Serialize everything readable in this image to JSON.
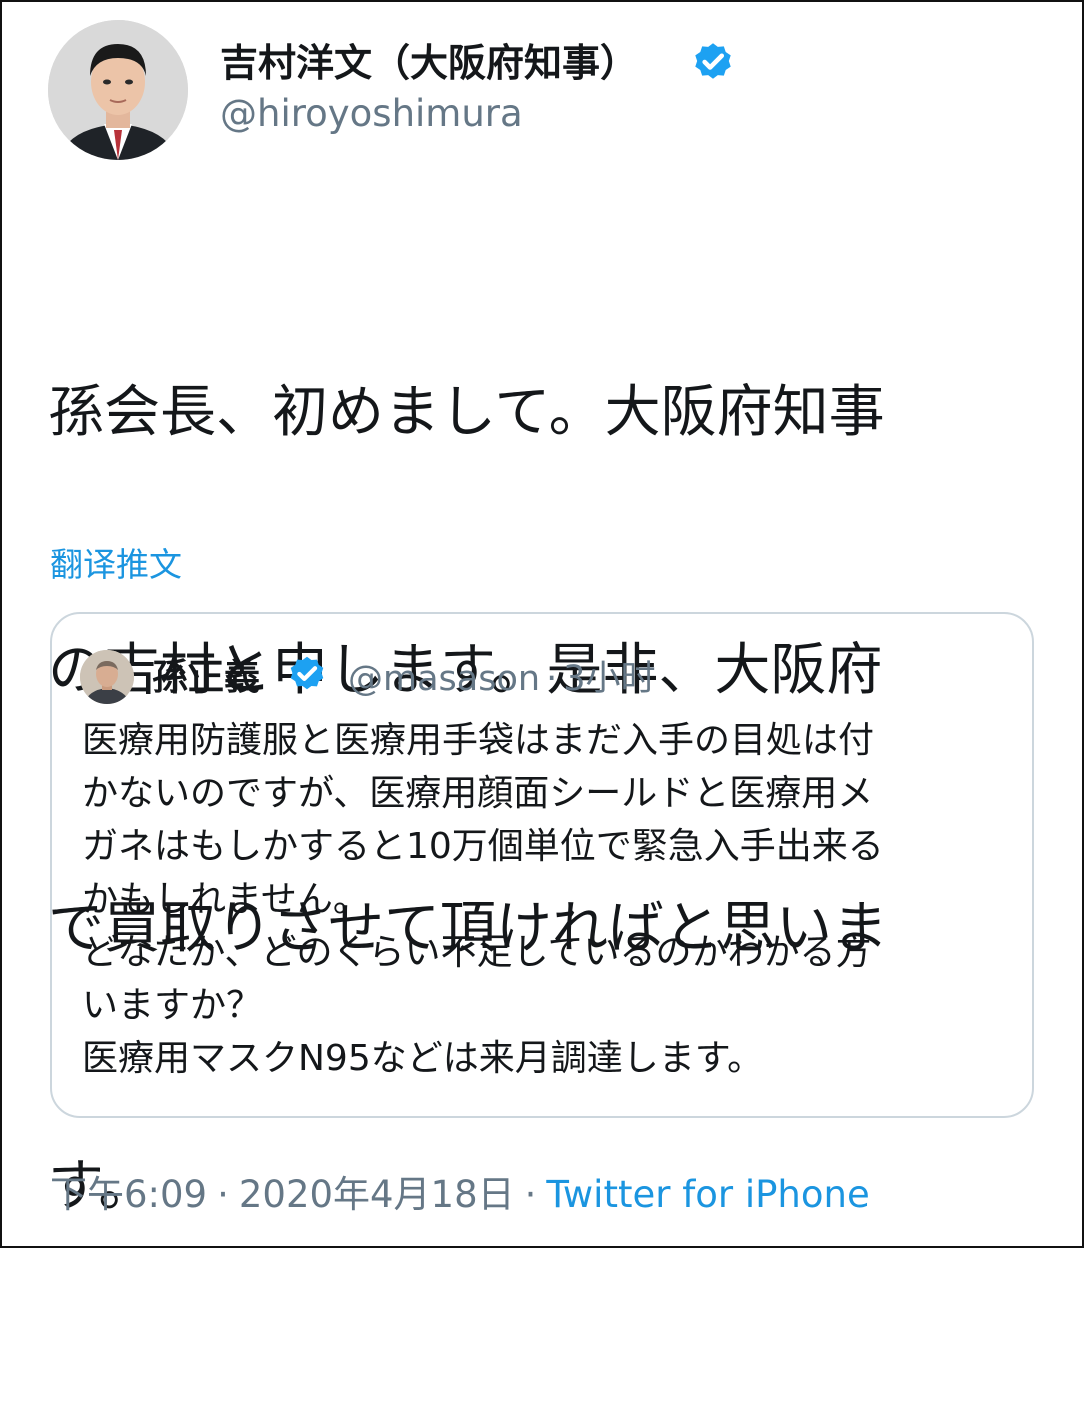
{
  "author": {
    "name": "吉村洋文（大阪府知事）",
    "handle": "@hiroyoshimura"
  },
  "tweet": {
    "text": "孫会長、初めまして。大阪府知事の吉村と申します。是非、大阪府で買取りさせて頂ければと思います。",
    "lines": [
      "孫会長、初めまして。大阪府知事",
      "の吉村と申します。是非、大阪府",
      "で買取りさせて頂ければと思いま",
      "す。"
    ],
    "translate_label": "翻译推文"
  },
  "quoted": {
    "name": "孫正義",
    "handle": "@masason",
    "time": "3小时",
    "lines": [
      "医療用防護服と医療用手袋はまだ入手の目処は付",
      "かないのですが、医療用顔面シールドと医療用メ",
      "ガネはもしかすると10万個単位で緊急入手出来る",
      "かもしれません。",
      "どなたか、どのくらい不足しているのかわかる方",
      "いますか？",
      "医療用マスクN95などは来月調達します。"
    ]
  },
  "footer": {
    "time": "下午6:09",
    "date": "2020年4月18日",
    "source": "Twitter for iPhone",
    "separator": "·"
  },
  "colors": {
    "verified": "#1da1f2",
    "link": "#1b95e0",
    "secondary_text": "#657786",
    "quote_border": "#ccd6dd"
  },
  "icons": {
    "verified": "verified-badge-icon"
  }
}
